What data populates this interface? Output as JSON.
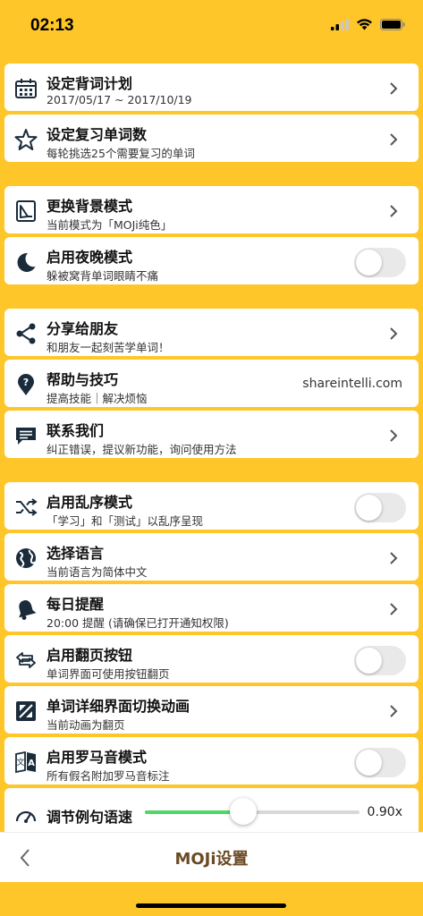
{
  "status": {
    "time": "02:13"
  },
  "items": {
    "plan": {
      "title": "设定背词计划",
      "subtitle": "2017/05/17 ~ 2017/10/19"
    },
    "review": {
      "title": "设定复习单词数",
      "subtitle": "每轮挑选25个需要复习的单词"
    },
    "background": {
      "title": "更换背景模式",
      "subtitle": "当前模式为「MOJi纯色」"
    },
    "night": {
      "title": "启用夜晚模式",
      "subtitle": "躲被窝背单词眼睛不痛",
      "on": false
    },
    "share": {
      "title": "分享给朋友",
      "subtitle": "和朋友一起刻苦学单词！"
    },
    "help": {
      "title": "帮助与技巧",
      "subtitle": "提高技能｜解决烦恼",
      "value": "shareintelli.com"
    },
    "contact": {
      "title": "联系我们",
      "subtitle": "纠正错误，提议新功能，询问使用方法"
    },
    "shuffle": {
      "title": "启用乱序模式",
      "subtitle": "「学习」和「测试」以乱序呈现",
      "on": false
    },
    "language": {
      "title": "选择语言",
      "subtitle": "当前语言为简体中文"
    },
    "reminder": {
      "title": "每日提醒",
      "subtitle": "20:00 提醒 (请确保已打开通知权限)"
    },
    "pagebtn": {
      "title": "启用翻页按钮",
      "subtitle": "单词界面可使用按钮翻页",
      "on": false
    },
    "animation": {
      "title": "单词详细界面切换动画",
      "subtitle": "当前动画为翻页"
    },
    "romaji": {
      "title": "启用罗马音模式",
      "subtitle": "所有假名附加罗马音标注",
      "on": false
    },
    "speed": {
      "title": "调节例句语速",
      "value": "0.90x",
      "level": 0.46
    }
  },
  "nav": {
    "title": "MOJi设置"
  },
  "colors": {
    "background": "#FFC62A",
    "card": "#FFFFFF",
    "slider_fill": "#4CD964",
    "nav_title": "#6B4A24",
    "icon": "#1A2B3C"
  }
}
